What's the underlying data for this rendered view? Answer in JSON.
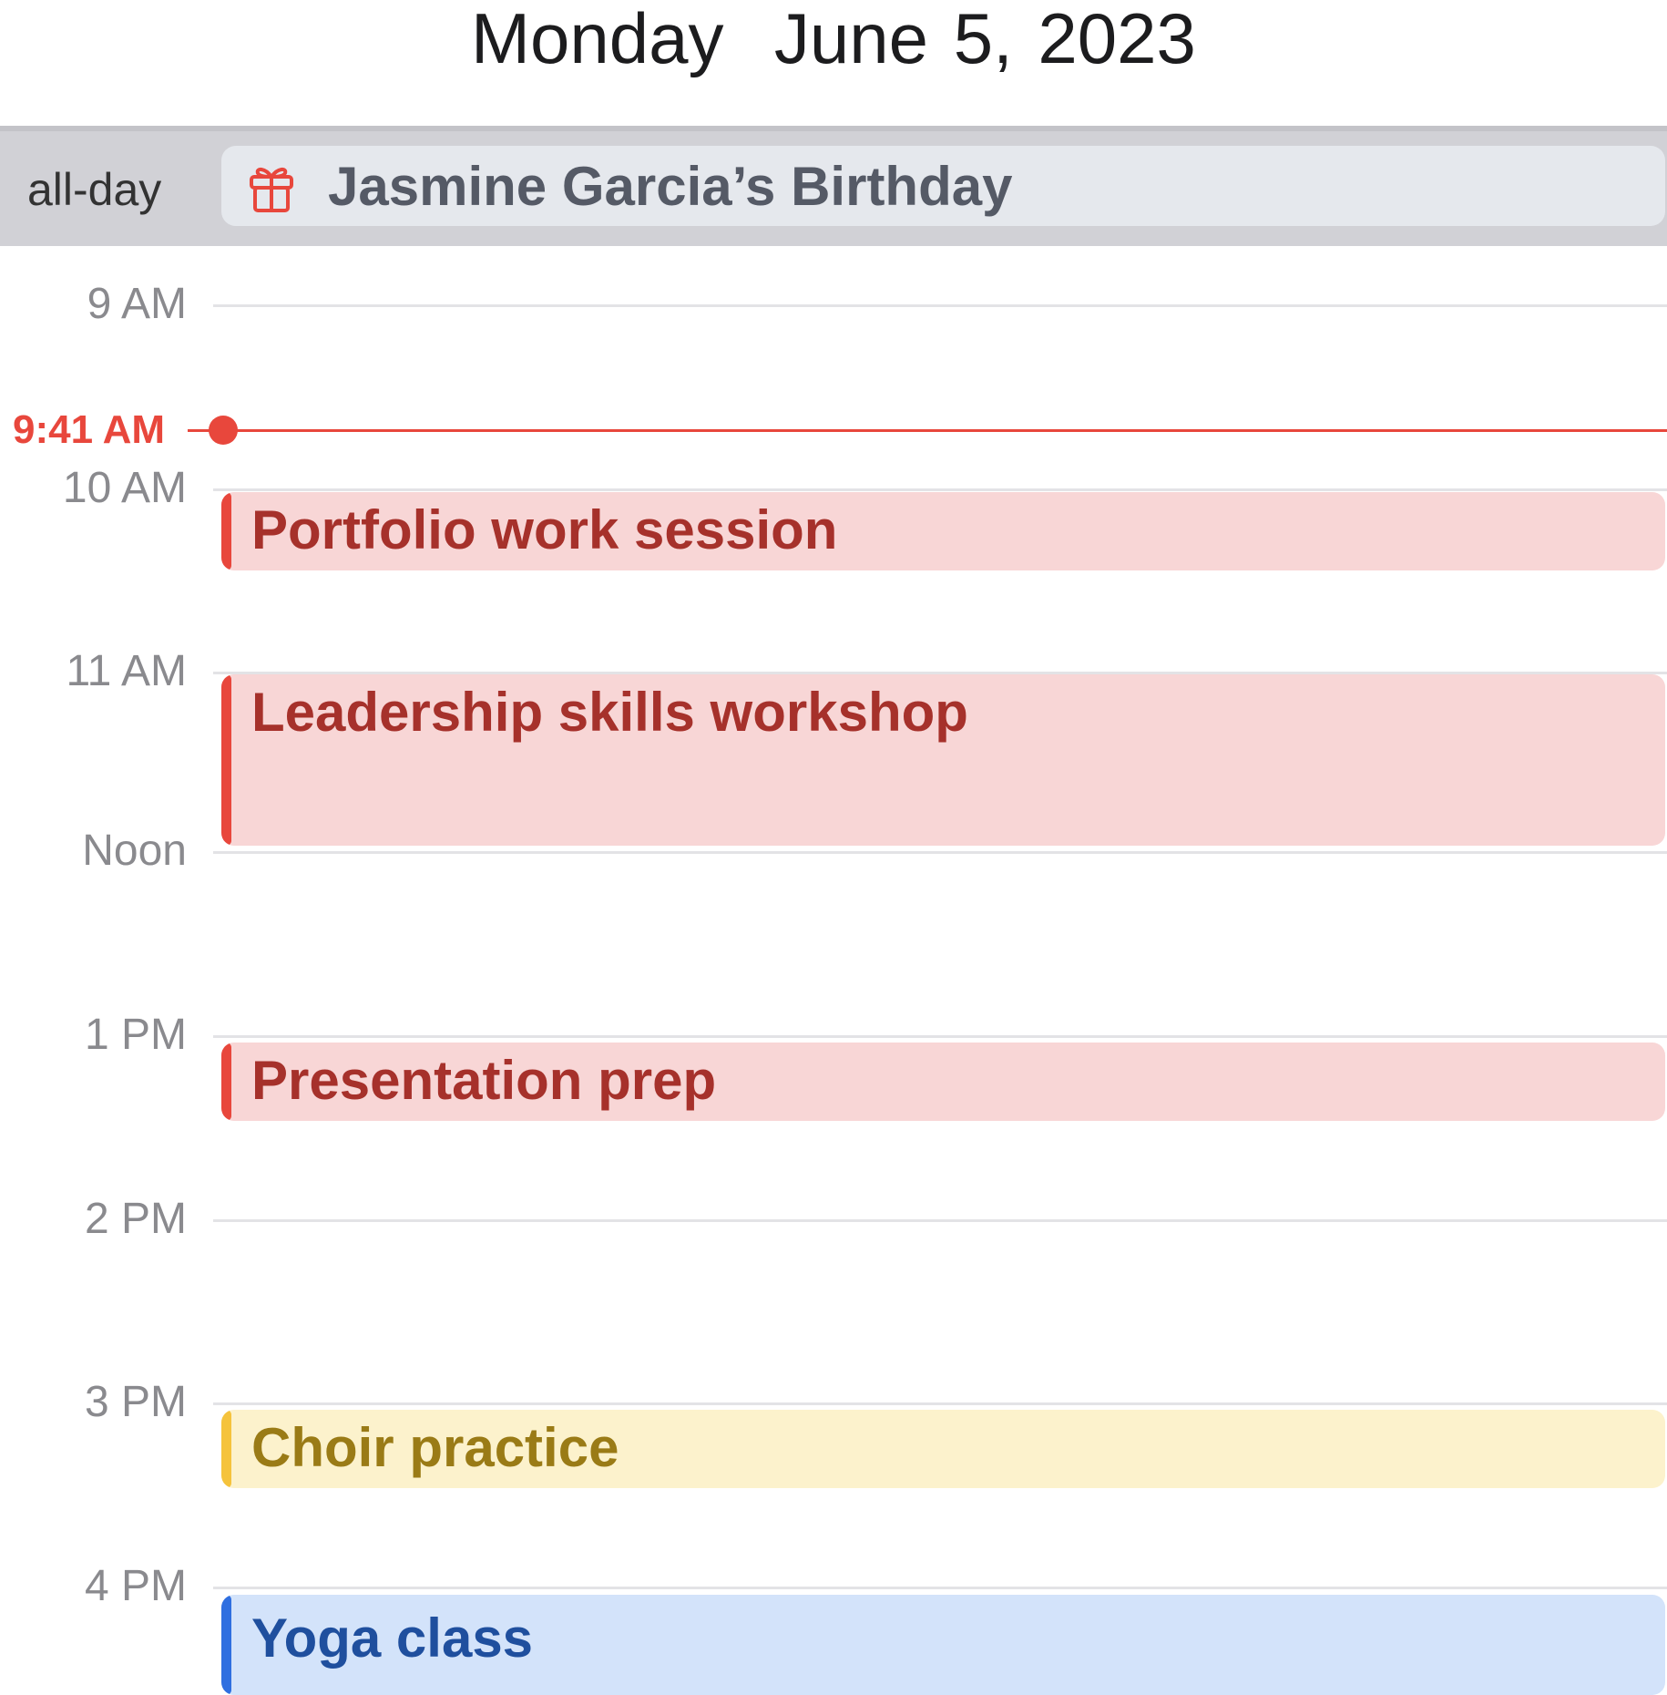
{
  "header": {
    "title": "Monday  June 5, 2023"
  },
  "all_day": {
    "label": "all-day",
    "event": {
      "icon": "gift-icon",
      "title": "Jasmine Garcia’s Birthday"
    }
  },
  "timeline": {
    "hours": [
      "9 AM",
      "10 AM",
      "11 AM",
      "Noon",
      "1 PM",
      "2 PM",
      "3 PM",
      "4 PM"
    ],
    "current_time": "9:41 AM"
  },
  "events": [
    {
      "title": "Portfolio work session",
      "color": "#e8473c"
    },
    {
      "title": "Leadership skills workshop",
      "color": "#e8473c"
    },
    {
      "title": "Presentation prep",
      "color": "#e8473c"
    },
    {
      "title": "Choir practice",
      "color": "#f5c33c"
    },
    {
      "title": "Yoga class",
      "color": "#2f6fe0"
    }
  ]
}
